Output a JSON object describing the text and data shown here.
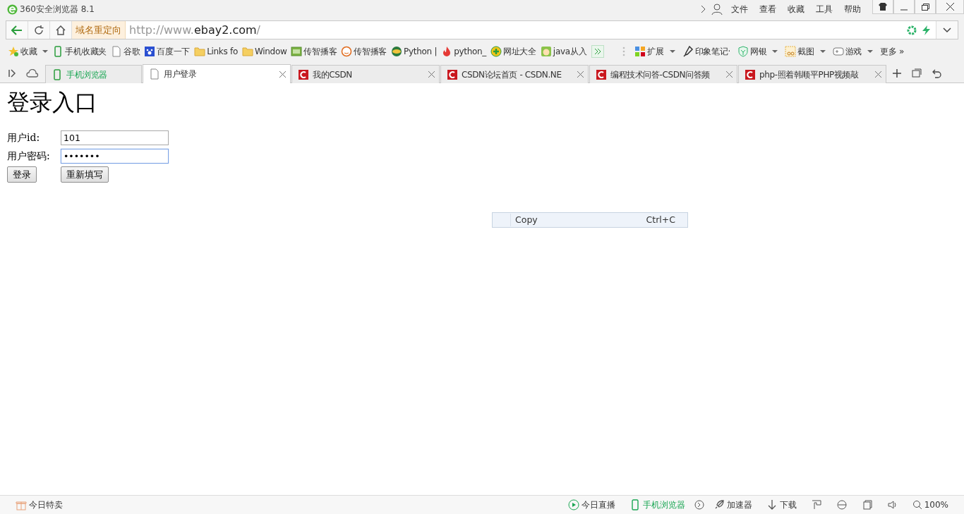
{
  "window": {
    "title": "360安全浏览器 8.1"
  },
  "menu": [
    "文件",
    "查看",
    "收藏",
    "工具",
    "帮助"
  ],
  "address_bar": {
    "redirect_tag": "域名重定向",
    "url": {
      "prefix": "http://www.",
      "domain": "ebay2.com",
      "suffix": "/"
    }
  },
  "bookmarks": [
    {
      "label": "收藏",
      "dropdown": true
    },
    {
      "label": "手机收藏夹",
      "dropdown": false
    },
    {
      "label": "谷歌",
      "dropdown": false
    },
    {
      "label": "百度一下",
      "dropdown": false
    },
    {
      "label": "Links fo",
      "dropdown": false
    },
    {
      "label": "Window",
      "dropdown": false
    },
    {
      "label": "传智播客",
      "dropdown": false
    },
    {
      "label": "传智播客",
      "dropdown": false
    },
    {
      "label": "Python |",
      "dropdown": false
    },
    {
      "label": "python_",
      "dropdown": false
    },
    {
      "label": "网址大全",
      "dropdown": false
    },
    {
      "label": "java从入",
      "dropdown": false
    }
  ],
  "extensions": [
    {
      "label": "扩展",
      "dropdown": true
    },
    {
      "label": "印象笔记·",
      "dropdown": false
    },
    {
      "label": "网银",
      "dropdown": true
    },
    {
      "label": "截图",
      "dropdown": true
    },
    {
      "label": "游戏",
      "dropdown": true
    },
    {
      "label": "更多 »",
      "dropdown": false
    }
  ],
  "tabs": [
    {
      "kind": "mobile",
      "label": "手机浏览器",
      "selected": false
    },
    {
      "kind": "page",
      "label": "用户登录",
      "selected": true
    },
    {
      "kind": "csdn",
      "label": "我的CSDN",
      "selected": false
    },
    {
      "kind": "csdn",
      "label": "CSDN论坛首页 - CSDN.NE",
      "selected": false
    },
    {
      "kind": "csdn",
      "label": "编程技术问答-CSDN问答频",
      "selected": false
    },
    {
      "kind": "csdn",
      "label": "php-照着韩顺平PHP视频敲",
      "selected": false
    }
  ],
  "page": {
    "heading": "登录入口",
    "fields": [
      {
        "label": "用户id:",
        "value": "101",
        "focused": false
      },
      {
        "label": "用户密码:",
        "value": "•••••••",
        "focused": true
      }
    ],
    "buttons": [
      "登录",
      "重新填写"
    ]
  },
  "context_menu": [
    {
      "label": "Copy",
      "shortcut": "Ctrl+C"
    }
  ],
  "status_bar": {
    "left": "今日特卖",
    "right": [
      {
        "kind": "live",
        "label": "今日直播"
      },
      {
        "kind": "mobile",
        "label": "手机浏览器"
      },
      {
        "kind": "speed",
        "label": "加速器"
      },
      {
        "kind": "download",
        "label": "下载"
      }
    ],
    "zoom": "100%"
  }
}
